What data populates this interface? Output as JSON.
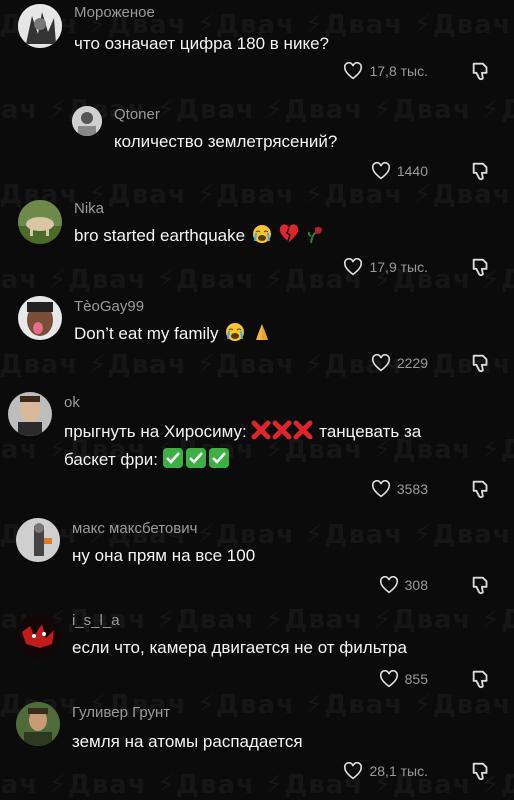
{
  "watermark": "Двач",
  "comments": [
    {
      "username": "Мороженое",
      "text": "что означает цифра 180 в нике?",
      "likes": "17,8 тыс."
    },
    {
      "username": "Qtoner",
      "text": "количество землетрясений?",
      "likes": "1440"
    },
    {
      "username": "Nika",
      "text": "bro started earthquake",
      "likes": "17,9 тыс."
    },
    {
      "username": "TèoGay99",
      "text": "Don’t eat my family",
      "likes": "2229"
    },
    {
      "username": "ok",
      "text_part1": "прыгнуть на Хиросиму:",
      "text_part2": "танцевать за",
      "text_part3": "баскет фри:",
      "likes": "3583"
    },
    {
      "username": "макс максбетович",
      "text": "ну она прям на все 100",
      "likes": "308"
    },
    {
      "username": "i_s_l_a",
      "text": "если что, камера двигается не от фильтра",
      "likes": "855"
    },
    {
      "username": "Гуливер Грунт",
      "text": "земля на атомы распадается",
      "likes": "28,1 тыс."
    }
  ],
  "icons": {
    "heart": "heart-outline-icon",
    "dislike": "thumbs-down-outline-icon"
  },
  "colors": {
    "background": "#0b0b0b",
    "username": "#9a9a9a",
    "text": "#f4f4f4",
    "watermark": "#161616",
    "cross": "#e0242c",
    "check": "#3cb043"
  }
}
